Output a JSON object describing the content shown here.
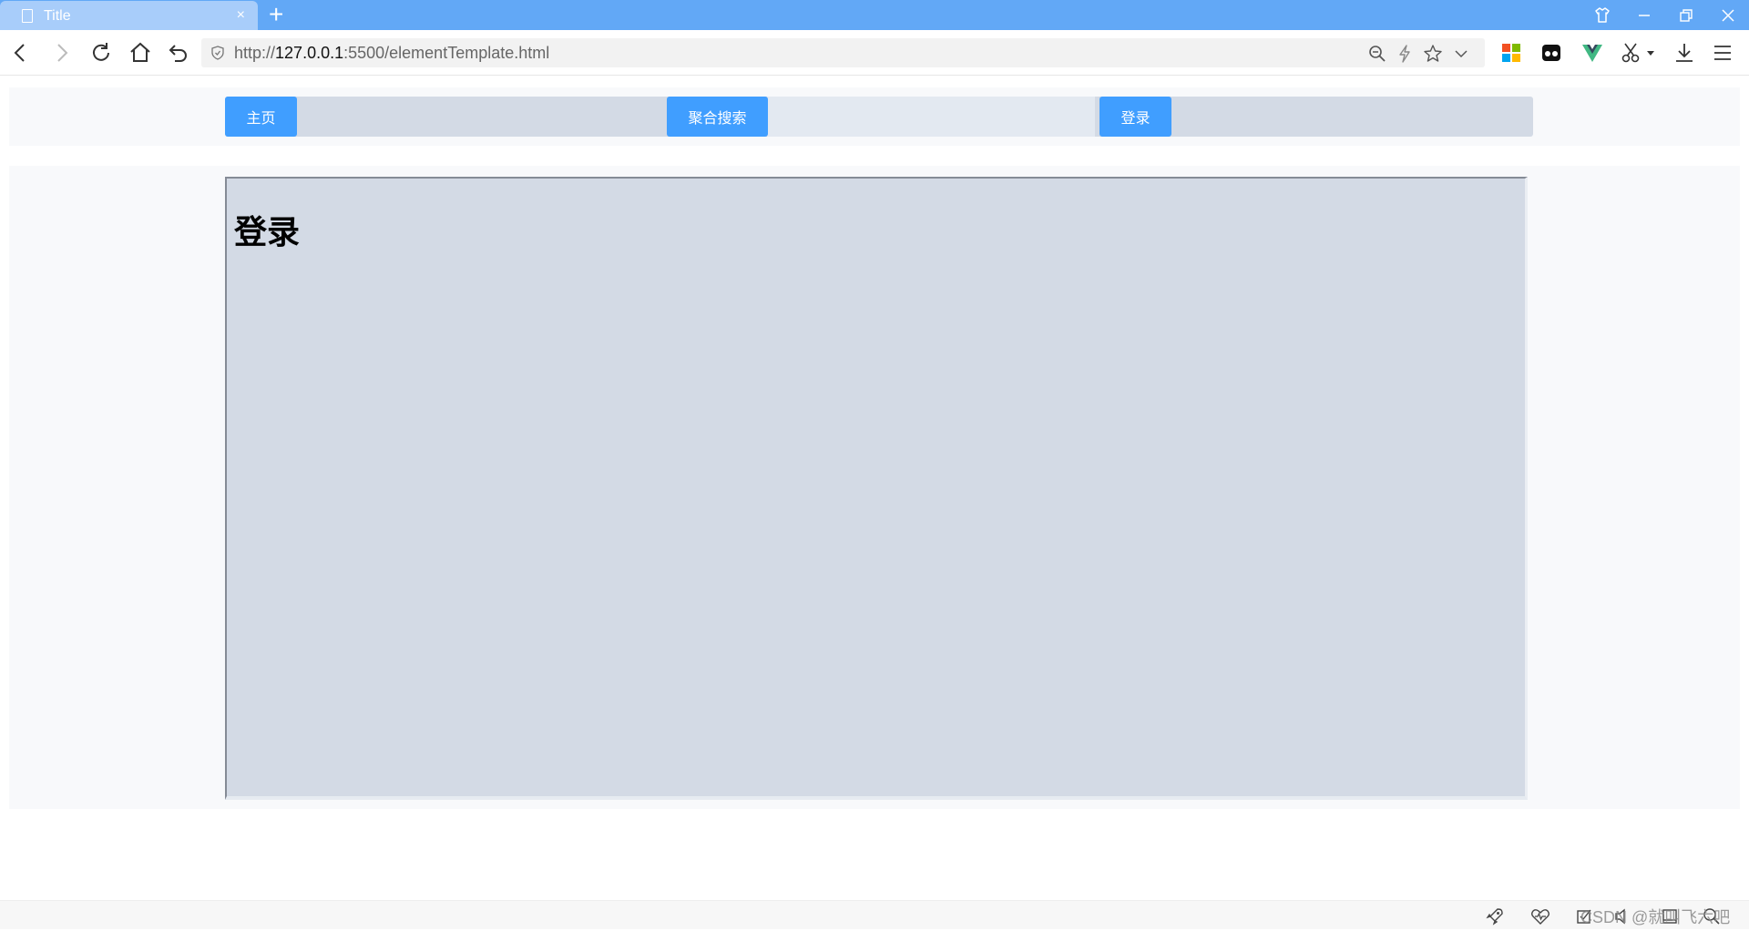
{
  "browser": {
    "tab_title": "Title",
    "tab_close": "×",
    "new_tab": "+",
    "url_scheme": "http://",
    "url_host": "127.0.0.1",
    "url_rest": ":5500/elementTemplate.html"
  },
  "menu": {
    "items": [
      {
        "label": "主页"
      },
      {
        "label": "聚合搜索"
      },
      {
        "label": "登录"
      }
    ]
  },
  "main": {
    "heading": "登录"
  },
  "statusbar": {
    "watermark": "CSDN @就叫飞六吧"
  },
  "colors": {
    "titlebar": "#62a8f6",
    "accent_button": "#409eff",
    "panel": "#d3dae5"
  }
}
